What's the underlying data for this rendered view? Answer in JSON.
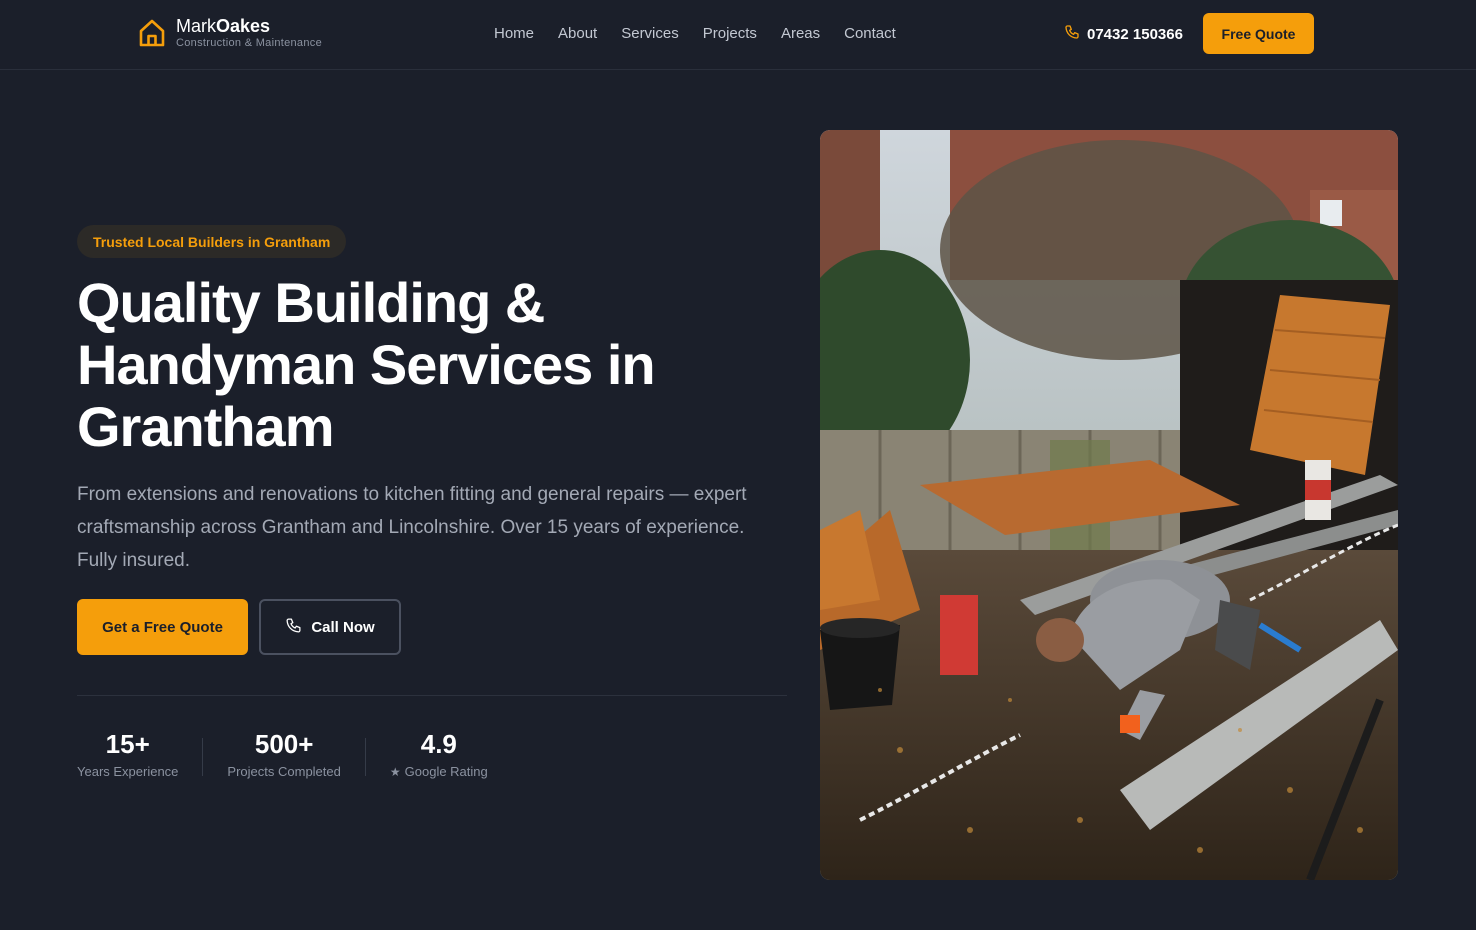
{
  "brand": {
    "name_regular": "Mark",
    "name_bold": "Oakes",
    "tagline": "Construction & Maintenance",
    "accent": "#f59e0b"
  },
  "nav": {
    "items": [
      {
        "label": "Home"
      },
      {
        "label": "About"
      },
      {
        "label": "Services"
      },
      {
        "label": "Projects"
      },
      {
        "label": "Areas"
      },
      {
        "label": "Contact"
      }
    ],
    "phone": "07432 150366",
    "cta": "Free Quote"
  },
  "hero": {
    "badge": "Trusted Local Builders in Grantham",
    "title": "Quality Building & Handyman Services in Grantham",
    "lead": "From extensions and renovations to kitchen fitting and general repairs — expert craftsmanship across Grantham and Lincolnshire. Over 15 years of experience. Fully insured.",
    "primary_cta": "Get a Free Quote",
    "secondary_cta": "Call Now"
  },
  "stats": [
    {
      "value": "15+",
      "label": "Years Experience"
    },
    {
      "value": "500+",
      "label": "Projects Completed"
    },
    {
      "value": "4.9",
      "label": "Google Rating",
      "icon": "star-icon"
    }
  ],
  "colors": {
    "background": "#1b1f2a",
    "text_muted": "#a3a9b5"
  }
}
